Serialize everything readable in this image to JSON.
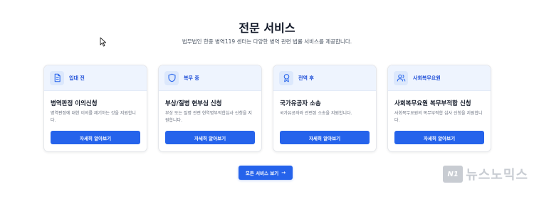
{
  "section": {
    "title": "전문 서비스",
    "subtitle": "법무법인 한중 병역119 센터는 다양한 병역 관련 법률 서비스를 제공합니다."
  },
  "cards": [
    {
      "icon": "document-icon",
      "tag": "입대 전",
      "title": "병역판정 이의신청",
      "desc": "병역판정에 대한 이의를 제기하는 것을 지원합니다.",
      "button": "자세히 알아보기"
    },
    {
      "icon": "shield-icon",
      "tag": "복무 중",
      "title": "부상/질병 현부심 신청",
      "desc": "부상 또는 질병 관련 현역병부적합심사 신청을 지원합니다.",
      "button": "자세히 알아보기"
    },
    {
      "icon": "award-icon",
      "tag": "전역 후",
      "title": "국가유공자 소송",
      "desc": "국가유공자와 관련된 소송을 지원합니다.",
      "button": "자세히 알아보기"
    },
    {
      "icon": "users-icon",
      "tag": "사회복무요원",
      "title": "사회복무요원 복무부적합 신청",
      "desc": "사회복무요원의 복무부적합 심사 신청을 지원합니다.",
      "button": "자세히 알아보기"
    }
  ],
  "all_services_button": {
    "label": "모든 서비스 보기",
    "arrow": "→"
  },
  "watermark": {
    "logo": "N1",
    "text": "뉴스노믹스"
  },
  "colors": {
    "accent": "#2563eb",
    "card_header": "#eef4fe",
    "tag_text": "#1d4ed8"
  }
}
